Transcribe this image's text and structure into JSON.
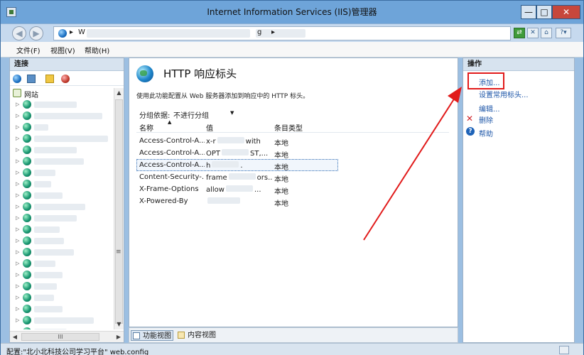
{
  "window": {
    "title": "Internet Information Services (IIS)管理器",
    "minimize_glyph": "—",
    "maximize_glyph": "□",
    "close_glyph": "✕"
  },
  "address": {
    "segments": [
      "▸",
      "W",
      "▸",
      "g",
      "▸"
    ]
  },
  "menu": {
    "items": [
      "文件(F)",
      "视图(V)",
      "帮助(H)"
    ]
  },
  "connections": {
    "header": "连接",
    "root_label": "网站",
    "site_count": 21
  },
  "center": {
    "title": "HTTP 响应标头",
    "description": "使用此功能配置从 Web 服务器添加到响应中的 HTTP 标头。",
    "group_label": "分组依据:",
    "group_value": "不进行分组",
    "columns": [
      "名称",
      "值",
      "条目类型"
    ],
    "rows": [
      {
        "name": "Access-Control-A...",
        "value": "x-r",
        "value_tail": "with",
        "type": "本地"
      },
      {
        "name": "Access-Control-A...",
        "value": "OPT",
        "value_tail": "ST,...",
        "type": "本地"
      },
      {
        "name": "Access-Control-A...",
        "value": "h",
        "value_tail": ".",
        "type": "本地"
      },
      {
        "name": "Content-Security-...",
        "value": "frame",
        "value_tail": "ors...",
        "type": "本地"
      },
      {
        "name": "X-Frame-Options",
        "value": "allow",
        "value_tail": "...",
        "type": "本地"
      },
      {
        "name": "X-Powered-By",
        "value": "",
        "value_tail": "",
        "type": "本地"
      }
    ],
    "selected_row": 2
  },
  "views": {
    "features": "功能视图",
    "content": "内容视图"
  },
  "actions": {
    "header": "操作",
    "add": "添加...",
    "set_common": "设置常用标头...",
    "edit": "编辑...",
    "delete": "删除",
    "help": "帮助",
    "delete_glyph": "✕",
    "help_glyph": "?"
  },
  "status": {
    "text": "配置:\"北小北科技公司学习平台\" web.config"
  },
  "colors": {
    "annotation_red": "#e11b1b",
    "link_blue": "#1d56a8"
  }
}
